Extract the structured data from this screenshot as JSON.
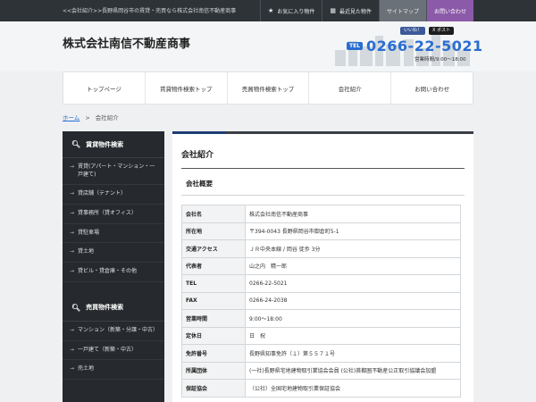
{
  "topbar": {
    "crumb": "<<会社紹介>>長野県岡谷市の賃貸・売買なら株式会社南信不動産商事",
    "nav": [
      {
        "icon": "★",
        "label": "お気に入り物件"
      },
      {
        "icon": "▦",
        "label": "最近見た物件"
      },
      {
        "icon": "",
        "label": "サイトマップ"
      },
      {
        "icon": "",
        "label": "お問い合わせ"
      }
    ]
  },
  "header": {
    "company": "株式会社南信不動産商事",
    "social": {
      "facebook": "いいね！",
      "twitter": "X ポスト"
    },
    "tel_label": "TEL",
    "tel": "0266-22-5021",
    "hours": "営業時間/9:00～18:00"
  },
  "gnav": [
    "トップページ",
    "賃貸物件検索トップ",
    "売買物件検索トップ",
    "会社紹介",
    "お問い合わせ"
  ],
  "breadcrumb": {
    "home": "ホーム",
    "sep": ">",
    "current": "会社紹介"
  },
  "sidebar": {
    "rent_title": "賃貸物件検索",
    "rent_items": [
      "賃貸(アパート・マンション・一戸建て)",
      "貸店舗（テナント）",
      "貸事務所（貸オフィス）",
      "貸駐車場",
      "貸土地",
      "貸ビル・貸倉庫・その他"
    ],
    "sale_title": "売買物件検索",
    "sale_items": [
      "マンション（新築・分譲・中古）",
      "一戸建て（新築・中古）",
      "売土地"
    ]
  },
  "main": {
    "title": "会社紹介",
    "section": "会社概要",
    "rows": [
      {
        "k": "会社名",
        "v": "株式会社南信不動産商事"
      },
      {
        "k": "所在地",
        "v": "〒394-0043 長野県岡谷市御倉町5-1"
      },
      {
        "k": "交通アクセス",
        "v": "ＪＲ中央本線 / 岡谷 徒歩 3分"
      },
      {
        "k": "代表者",
        "v": "山之内　精一郎"
      },
      {
        "k": "TEL",
        "v": "0266-22-5021"
      },
      {
        "k": "FAX",
        "v": "0266-24-2038"
      },
      {
        "k": "営業時間",
        "v": "9:00～18:00"
      },
      {
        "k": "定休日",
        "v": "日　祝"
      },
      {
        "k": "免許番号",
        "v": "長野県知事免許（１）第５５７１号"
      },
      {
        "k": "所属団体",
        "v": "(一社)長野県宅地建物取引業協会会員 (公社)首都圏不動産公正取引協議会加盟"
      },
      {
        "k": "保証協会",
        "v": "（公社）全国宅地建物取引業保証協会"
      }
    ]
  }
}
